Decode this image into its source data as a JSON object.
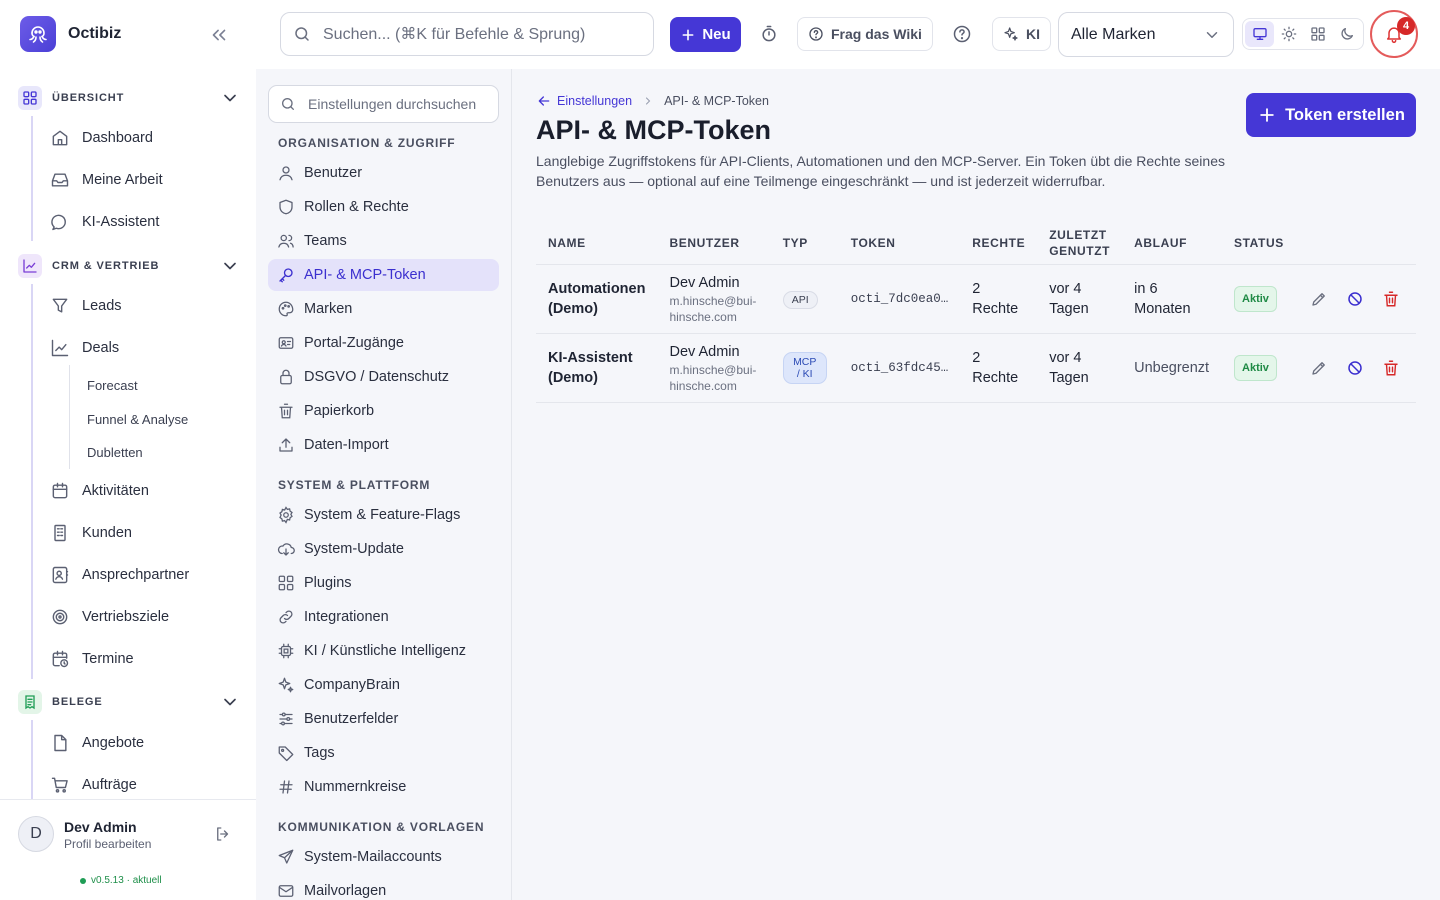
{
  "app": {
    "name": "Octibiz"
  },
  "topbar": {
    "search_placeholder": "Suchen... (⌘K für Befehle & Sprung)",
    "new_label": "Neu",
    "wiki_label": "Frag das Wiki",
    "ai_label": "KI",
    "brand_select_value": "Alle Marken",
    "notification_count": "4"
  },
  "nav": {
    "sections": [
      {
        "title": "ÜBERSICHT",
        "items": [
          "Dashboard",
          "Meine Arbeit",
          "KI-Assistent"
        ]
      },
      {
        "title": "CRM & VERTRIEB",
        "items": [
          "Leads",
          "Deals",
          "Aktivitäten",
          "Kunden",
          "Ansprechpartner",
          "Vertriebsziele",
          "Termine"
        ],
        "deal_subitems": [
          "Forecast",
          "Funnel & Analyse",
          "Dubletten"
        ]
      },
      {
        "title": "BELEGE",
        "items": [
          "Angebote",
          "Aufträge"
        ]
      }
    ],
    "user": {
      "initial": "D",
      "name": "Dev Admin",
      "sub": "Profil bearbeiten"
    },
    "version": "v0.5.13 · aktuell"
  },
  "settings": {
    "search_placeholder": "Einstellungen durchsuchen",
    "groups": [
      {
        "title": "ORGANISATION & ZUGRIFF",
        "items": [
          "Benutzer",
          "Rollen & Rechte",
          "Teams",
          "API- & MCP-Token",
          "Marken",
          "Portal-Zugänge",
          "DSGVO / Datenschutz",
          "Papierkorb",
          "Daten-Import"
        ]
      },
      {
        "title": "SYSTEM & PLATTFORM",
        "items": [
          "System & Feature-Flags",
          "System-Update",
          "Plugins",
          "Integrationen",
          "KI / Künstliche Intelligenz",
          "CompanyBrain",
          "Benutzerfelder",
          "Tags",
          "Nummernkreise"
        ]
      },
      {
        "title": "KOMMUNIKATION & VORLAGEN",
        "items": [
          "System-Mailaccounts",
          "Mailvorlagen"
        ]
      }
    ]
  },
  "main": {
    "breadcrumb": {
      "parent": "Einstellungen",
      "current": "API- & MCP-Token"
    },
    "title": "API- & MCP-Token",
    "description": "Langlebige Zugriffstokens für API-Clients, Automationen und den MCP-Server. Ein Token übt die Rechte seines Benutzers aus — optional auf eine Teilmenge eingeschränkt — und ist jederzeit widerrufbar.",
    "create_label": "Token erstellen",
    "table": {
      "headers": [
        "NAME",
        "BENUTZER",
        "TYP",
        "TOKEN",
        "RECHTE",
        "ZULETZT GENUTZT",
        "ABLAUF",
        "STATUS"
      ],
      "rows": [
        {
          "name": "Automationen (Demo)",
          "user": "Dev Admin",
          "email": "m.hinsche@bui-hinsche.com",
          "type": "API",
          "token": "octi_7dc0ea0…",
          "rights": "2 Rechte",
          "last_used": "vor 4 Tagen",
          "expiry": "in 6 Monaten",
          "status": "Aktiv"
        },
        {
          "name": "KI-Assistent (Demo)",
          "user": "Dev Admin",
          "email": "m.hinsche@bui-hinsche.com",
          "type": "MCP / KI",
          "token": "octi_63fdc45…",
          "rights": "2 Rechte",
          "last_used": "vor 4 Tagen",
          "expiry": "Unbegrenzt",
          "status": "Aktiv"
        }
      ]
    }
  },
  "colors": {
    "accent": "#4537d6",
    "status_active": "#1f8a45",
    "danger": "#d62828"
  }
}
